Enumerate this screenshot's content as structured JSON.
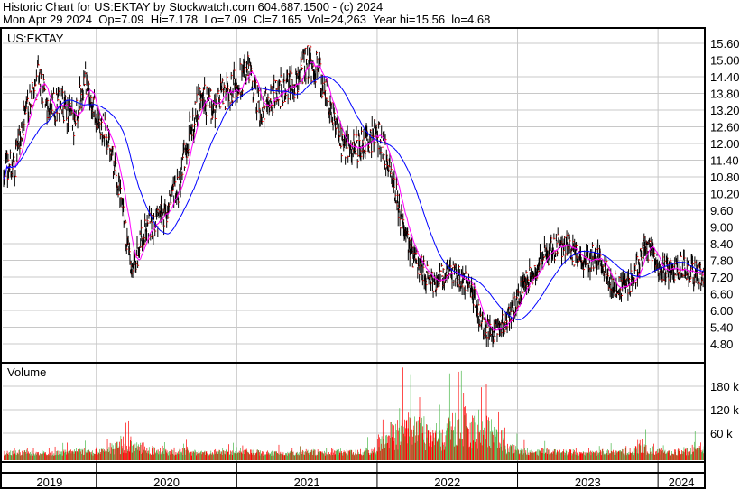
{
  "header": {
    "title": "Historic Chart for US:EKTAY by Stockwatch.com 604.687.1500 - (c) 2024",
    "quote": "Mon Apr 29 2024  Op=7.09  Hi=7.178  Lo=7.09  Cl=7.165  Vol=24,263  Year hi=15.56  lo=4.68"
  },
  "chart_data": {
    "type": "bar",
    "symbol": "US:EKTAY",
    "volume_label": "Volume",
    "price_ticks": [
      "15.60",
      "15.00",
      "14.40",
      "13.80",
      "13.20",
      "12.60",
      "12.00",
      "11.40",
      "10.80",
      "10.20",
      "9.60",
      "9.00",
      "8.40",
      "7.80",
      "7.20",
      "6.60",
      "6.00",
      "5.40",
      "4.80"
    ],
    "price_range": [
      4.2,
      16.0
    ],
    "volume_ticks": [
      {
        "label": "180 k",
        "value": 180
      },
      {
        "label": "120 k",
        "value": 120
      },
      {
        "label": "60 k",
        "value": 60
      }
    ],
    "volume_range_k": [
      0,
      220
    ],
    "years": [
      "2019",
      "2020",
      "2021",
      "2022",
      "2023",
      "2024"
    ],
    "year_months": [
      8,
      12,
      12,
      12,
      12,
      4
    ],
    "start_month": "2019-05",
    "monthly_close": [
      11.2,
      13.4,
      14.3,
      13.2,
      13.4,
      12.8,
      14.3,
      12.8,
      12.2,
      10.2,
      7.2,
      8.8,
      9.2,
      9.6,
      10.4,
      12.6,
      13.6,
      13.4,
      13.8,
      14.2,
      14.6,
      13.2,
      13.6,
      14.0,
      14.2,
      15.0,
      14.6,
      13.4,
      11.8,
      11.8,
      12.0,
      12.4,
      11.4,
      9.4,
      8.0,
      7.4,
      7.0,
      7.4,
      7.2,
      6.9,
      5.4,
      5.2,
      5.6,
      6.4,
      7.2,
      7.8,
      8.2,
      8.4,
      8.0,
      7.8,
      8.0,
      7.0,
      6.8,
      7.2,
      8.4,
      7.6,
      7.4,
      7.6,
      7.4,
      7.1
    ],
    "monthly_avg_volume_k": [
      8,
      10,
      8,
      6,
      8,
      10,
      12,
      10,
      12,
      20,
      30,
      20,
      15,
      12,
      10,
      12,
      10,
      8,
      10,
      10,
      12,
      10,
      8,
      8,
      8,
      10,
      10,
      8,
      12,
      10,
      10,
      14,
      30,
      50,
      60,
      55,
      50,
      45,
      60,
      70,
      65,
      55,
      40,
      20,
      12,
      10,
      12,
      10,
      10,
      8,
      8,
      10,
      10,
      12,
      25,
      15,
      12,
      10,
      12,
      20
    ],
    "moving_averages": [
      {
        "name": "short",
        "period": 20,
        "color": "#ff00ff"
      },
      {
        "name": "long",
        "period": 80,
        "color": "#0000ff"
      }
    ],
    "colors": {
      "bar": "#000000",
      "close_tick": "#ff0000",
      "vol_up": "#4cb84c",
      "vol_down": "#ff0000",
      "grid": "#c8c8c8"
    }
  }
}
